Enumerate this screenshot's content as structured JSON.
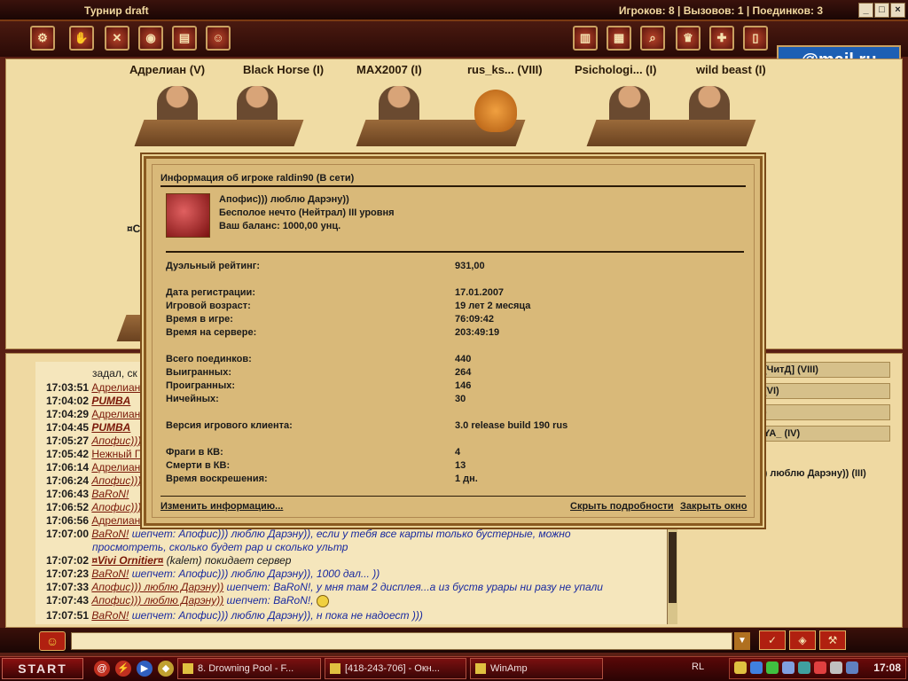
{
  "titlebar": {
    "title": "Турнир draft",
    "status": "Игроков: 8 | Вызовов: 1 | Поединков: 3"
  },
  "toolbar": {
    "left_icons": [
      "gear-icon",
      "hand-icon",
      "swords-icon",
      "coin-icon",
      "cards-icon",
      "people-icon"
    ],
    "right_icons": [
      "book-icon",
      "picture-icon",
      "search-icon",
      "trophy-icon",
      "shield-icon",
      "door-icon"
    ],
    "brand": "@mail.ru"
  },
  "lobby": {
    "players": [
      "Адрелиан (V)",
      "Black Horse (I)",
      "MAX2007 (I)",
      "rus_ks... (VIII)",
      "Psichologi... (I)",
      "wild beast (I)"
    ],
    "partial_label": "¤Ca"
  },
  "modal": {
    "title": "Информация об игроке raldin90 (В сети)",
    "profile": [
      "Апофис))) люблю Дарэну))",
      "Бесполое нечто (Нейтрал) III уровня",
      "Ваш баланс: 1000,00 унц."
    ],
    "stats": [
      {
        "label": "Дуэльный рейтинг:",
        "value": "931,00"
      },
      {
        "label": "Дата регистрации:",
        "value": "17.01.2007"
      },
      {
        "label": "Игровой возраст:",
        "value": "19 лет 2 месяца"
      },
      {
        "label": "Время в игре:",
        "value": "76:09:42"
      },
      {
        "label": "Время на сервере:",
        "value": "203:49:19"
      },
      {
        "label": "Всего поединков:",
        "value": "440"
      },
      {
        "label": "Выигранных:",
        "value": "264"
      },
      {
        "label": "Проигранных:",
        "value": "146"
      },
      {
        "label": "Ничейных:",
        "value": "30"
      },
      {
        "label": "Версия игрового клиента:",
        "value": "3.0 release build 190 rus"
      },
      {
        "label": "Фраги в КВ:",
        "value": "4"
      },
      {
        "label": "Смерти в КВ:",
        "value": "13"
      },
      {
        "label": "Время воскрешения:",
        "value": "1 дн."
      }
    ],
    "edit_link": "Изменить информацию...",
    "details_link": "Скрыть подробности",
    "close_link": "Закрыть окно"
  },
  "chat": [
    {
      "time": "",
      "nick": "",
      "text": "задал, ск"
    },
    {
      "time": "17:03:51",
      "nick": "Адрелиан",
      "text": ""
    },
    {
      "time": "17:04:02",
      "nick": "PUMBA",
      "text": ""
    },
    {
      "time": "17:04:29",
      "nick": "Адрелиан",
      "text": ""
    },
    {
      "time": "17:04:45",
      "nick": "PUMBA",
      "text": ""
    },
    {
      "time": "17:05:27",
      "nick": "Апофис)))",
      "text": ""
    },
    {
      "time": "17:05:42",
      "nick": "Нежный Г",
      "text": ""
    },
    {
      "time": "17:06:14",
      "nick": "Адрелиан",
      "text": ""
    },
    {
      "time": "17:06:24",
      "nick": "Апофис)))",
      "text": ""
    },
    {
      "time": "17:06:43",
      "nick": "BaRoN!",
      "text": ""
    },
    {
      "time": "17:06:52",
      "nick": "Апофис)))",
      "text": ""
    },
    {
      "time": "17:06:56",
      "nick": "Адрелиан",
      "text": ""
    },
    {
      "time": "17:07:00",
      "nick": "BaRoN!",
      "text": " шепчет: Апофис))) люблю Дарэну)), если у тебя все карты только бустерные, можно"
    },
    {
      "time": "",
      "nick": "",
      "text": "просмотреть, сколько будет рар и сколько ультр"
    },
    {
      "time": "17:07:02",
      "nick": "¤Vivi Ornitier¤",
      "text": " (kalem) покидает сервер"
    },
    {
      "time": "17:07:23",
      "nick": "BaRoN!",
      "text": " шепчет: Апофис))) люблю Дарэну)), 1000 дал... ))"
    },
    {
      "time": "17:07:33",
      "nick": "Апофис))) люблю Дарэну))",
      "text": " шепчет: BaRoN!, у мня там 2 дисплея...а из буств урары ни разу не упали"
    },
    {
      "time": "17:07:43",
      "nick": "Апофис))) люблю Дарэну))",
      "text": " шепчет: BaRoN!,"
    },
    {
      "time": "17:07:51",
      "nick": "BaRoN!",
      "text": " шепчет: Апофис))) люблю Дарэну)), н пока не надоест )))"
    }
  ],
  "users": [
    "[ЧитД] (VIII)",
    "(VI)",
    ")",
    "YA_ (IV)"
  ],
  "users_tail": ")) люблю Дарэну)) (III)",
  "taskbar": {
    "start": "START",
    "tasks": [
      "8. Drowning Pool - F...",
      "[418-243-706] - Окн...",
      "WinAmp"
    ],
    "lang": "RL",
    "clock": "17:08"
  }
}
